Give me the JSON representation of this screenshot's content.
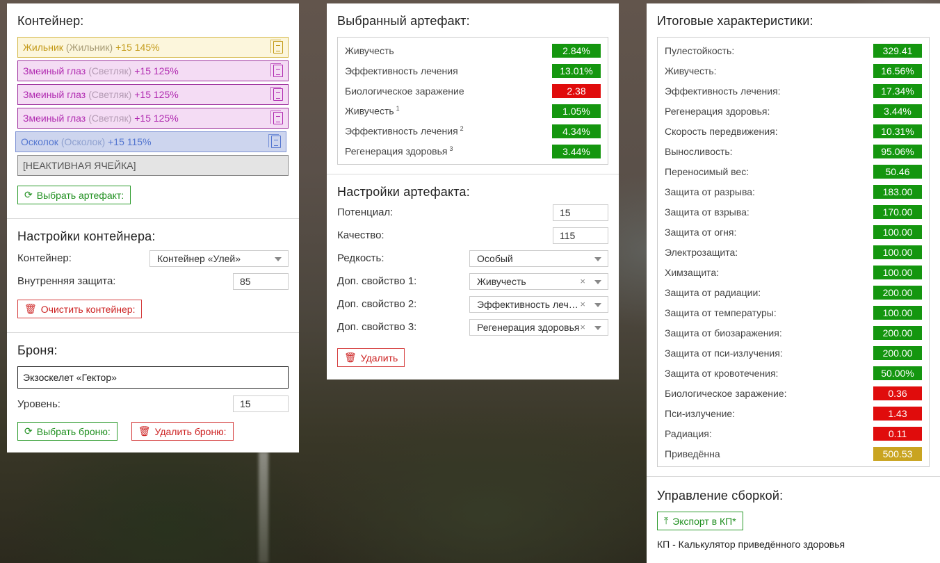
{
  "container": {
    "title": "Контейнер:",
    "slots": [
      {
        "name": "Жильник",
        "sub": "(Жильник)",
        "level": "+15 145%"
      },
      {
        "name": "Змеиный глаз",
        "sub": "(Светляк)",
        "level": "+15 125%"
      },
      {
        "name": "Змеиный глаз",
        "sub": "(Светляк)",
        "level": "+15 125%"
      },
      {
        "name": "Змеиный глаз",
        "sub": "(Светляк)",
        "level": "+15 125%"
      },
      {
        "name": "Осколок",
        "sub": "(Осколок)",
        "level": "+15 115%"
      }
    ],
    "inactive_slot": "[НЕАКТИВНАЯ ЯЧЕЙКА]",
    "select_artifact_btn": "Выбрать артефакт:"
  },
  "container_settings": {
    "title": "Настройки контейнера:",
    "container_label": "Контейнер:",
    "container_value": "Контейнер «Улей»",
    "protection_label": "Внутренняя защита:",
    "protection_value": "85",
    "clear_btn": "Очистить контейнер:"
  },
  "armor": {
    "title": "Броня:",
    "name": "Экзоскелет «Гектор»",
    "level_label": "Уровень:",
    "level_value": "15",
    "select_btn": "Выбрать броню:",
    "delete_btn": "Удалить броню:"
  },
  "selected_artifact": {
    "title": "Выбранный артефакт:",
    "stats": [
      {
        "label": "Живучесть",
        "sup": "",
        "value": "2.84%",
        "color": "green"
      },
      {
        "label": "Эффективность лечения",
        "sup": "",
        "value": "13.01%",
        "color": "green"
      },
      {
        "label": "Биологическое заражение",
        "sup": "",
        "value": "2.38",
        "color": "red"
      },
      {
        "label": "Живучесть",
        "sup": "1",
        "value": "1.05%",
        "color": "green"
      },
      {
        "label": "Эффективность лечения",
        "sup": "2",
        "value": "4.34%",
        "color": "green"
      },
      {
        "label": "Регенерация здоровья",
        "sup": "3",
        "value": "3.44%",
        "color": "green"
      }
    ]
  },
  "artifact_settings": {
    "title": "Настройки артефакта:",
    "potential_label": "Потенциал:",
    "potential_value": "15",
    "quality_label": "Качество:",
    "quality_value": "115",
    "rarity_label": "Редкость:",
    "rarity_value": "Особый",
    "extra1_label": "Доп. свойство 1:",
    "extra1_value": "Живучесть",
    "extra2_label": "Доп. свойство 2:",
    "extra2_value": "Эффективность лечения",
    "extra3_label": "Доп. свойство 3:",
    "extra3_value": "Регенерация здоровья",
    "delete_btn": "Удалить"
  },
  "totals": {
    "title": "Итоговые характеристики:",
    "stats": [
      {
        "label": "Пулестойкость:",
        "value": "329.41",
        "color": "green"
      },
      {
        "label": "Живучесть:",
        "value": "16.56%",
        "color": "green"
      },
      {
        "label": "Эффективность лечения:",
        "value": "17.34%",
        "color": "green"
      },
      {
        "label": "Регенерация здоровья:",
        "value": "3.44%",
        "color": "green"
      },
      {
        "label": "Скорость передвижения:",
        "value": "10.31%",
        "color": "green"
      },
      {
        "label": "Выносливость:",
        "value": "95.06%",
        "color": "green"
      },
      {
        "label": "Переносимый вес:",
        "value": "50.46",
        "color": "green"
      },
      {
        "label": "Защита от разрыва:",
        "value": "183.00",
        "color": "green"
      },
      {
        "label": "Защита от взрыва:",
        "value": "170.00",
        "color": "green"
      },
      {
        "label": "Защита от огня:",
        "value": "100.00",
        "color": "green"
      },
      {
        "label": "Электрозащита:",
        "value": "100.00",
        "color": "green"
      },
      {
        "label": "Химзащита:",
        "value": "100.00",
        "color": "green"
      },
      {
        "label": "Защита от радиации:",
        "value": "200.00",
        "color": "green"
      },
      {
        "label": "Защита от температуры:",
        "value": "100.00",
        "color": "green"
      },
      {
        "label": "Защита от биозаражения:",
        "value": "200.00",
        "color": "green"
      },
      {
        "label": "Защита от пси-излучения:",
        "value": "200.00",
        "color": "green"
      },
      {
        "label": "Защита от кровотечения:",
        "value": "50.00%",
        "color": "green"
      },
      {
        "label": "Биологическое заражение:",
        "value": "0.36",
        "color": "red"
      },
      {
        "label": "Пси-излучение:",
        "value": "1.43",
        "color": "red"
      },
      {
        "label": "Радиация:",
        "value": "0.11",
        "color": "red"
      },
      {
        "label": "Приведённа",
        "value": "500.53",
        "color": "gold"
      }
    ]
  },
  "build": {
    "title": "Управление сборкой:",
    "export_btn": "Экспорт в КП*",
    "footnote": "КП - Калькулятор приведённого здоровья"
  },
  "colors": {
    "green": "#14960f",
    "red": "#e00c0c",
    "gold": "#c9a420"
  },
  "icons": [
    "document-icon",
    "refresh-icon",
    "trash-icon",
    "upload-icon",
    "chevron-down-icon",
    "clear-icon"
  ]
}
